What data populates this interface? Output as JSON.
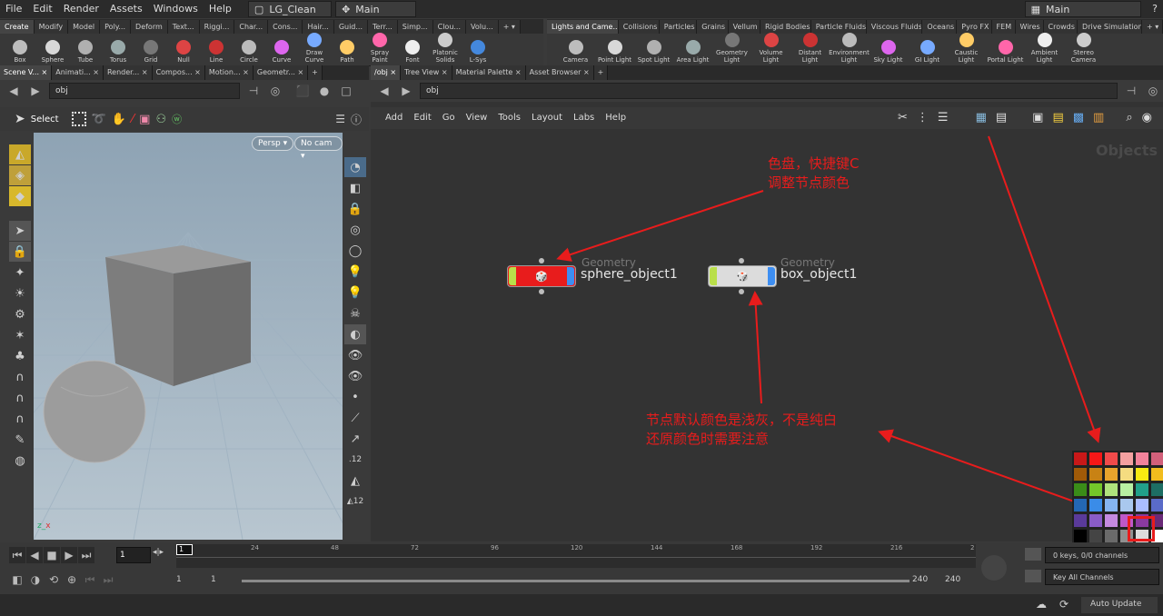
{
  "menubar": {
    "items": [
      "File",
      "Edit",
      "Render",
      "Assets",
      "Windows",
      "Help"
    ],
    "desktop": "LG_Clean",
    "layout": "Main",
    "right": "Main",
    "help": "?"
  },
  "shelf_left": {
    "tabs": [
      "Create",
      "Modify",
      "Model",
      "Poly...",
      "Deform",
      "Text...",
      "Riggi...",
      "Char...",
      "Cons...",
      "Hair...",
      "Guid...",
      "Terr...",
      "Simp...",
      "Clou...",
      "Volu..."
    ],
    "tools": [
      "Box",
      "Sphere",
      "Tube",
      "Torus",
      "Grid",
      "Null",
      "Line",
      "Circle",
      "Curve",
      "Draw Curve",
      "Path",
      "Spray Paint",
      "Font",
      "Platonic Solids",
      "L-Sys"
    ]
  },
  "shelf_right": {
    "tabs": [
      "Lights and Came...",
      "Collisions",
      "Particles",
      "Grains",
      "Vellum",
      "Rigid Bodies",
      "Particle Fluids",
      "Viscous Fluids",
      "Oceans",
      "Pyro FX",
      "FEM",
      "Wires",
      "Crowds",
      "Drive Simulation"
    ],
    "tools": [
      "Camera",
      "Point Light",
      "Spot Light",
      "Area Light",
      "Geometry Light",
      "Volume Light",
      "Distant Light",
      "Environment Light",
      "Sky Light",
      "GI Light",
      "Caustic Light",
      "Portal Light",
      "Ambient Light",
      "Stereo Camera"
    ]
  },
  "left_pane": {
    "tabs": [
      "Scene V...",
      "Animati...",
      "Render...",
      "Compos...",
      "Motion...",
      "Geometr..."
    ],
    "path": "obj",
    "select_label": "Select",
    "persp": "Persp",
    "nocam": "No cam"
  },
  "right_pane": {
    "tabs": [
      "/obj",
      "Tree View",
      "Material Palette",
      "Asset Browser"
    ],
    "path": "obj",
    "menu": [
      "Add",
      "Edit",
      "Go",
      "View",
      "Tools",
      "Layout",
      "Labs",
      "Help"
    ],
    "context_label": "Objects"
  },
  "nodes": [
    {
      "type": "Geometry",
      "name": "sphere_object1",
      "color": "#e81c1c"
    },
    {
      "type": "Geometry",
      "name": "box_object1",
      "color": "#dcdcdc"
    }
  ],
  "annotations": {
    "palette_note_1": "色盘，快捷键C",
    "palette_note_2": "调整节点颜色",
    "default_note_1": "节点默认颜色是浅灰，不是纯白",
    "default_note_2": "还原颜色时需要注意",
    "color": "#e81c1c"
  },
  "palette": [
    "#c81818",
    "#f51717",
    "#f04a4a",
    "#f3a0a0",
    "#f2829a",
    "#d2607a",
    "#a05a08",
    "#c88214",
    "#e9a42c",
    "#f5dc80",
    "#f8ea12",
    "#f2bd1e",
    "#3a8c18",
    "#74c72a",
    "#b0e37c",
    "#b8f0a2",
    "#21a08a",
    "#1d6e64",
    "#2467b4",
    "#3a8ce8",
    "#86b4f0",
    "#a9c8ee",
    "#aabdff",
    "#5a6bc8",
    "#5a3a9a",
    "#8a5cc8",
    "#c48ae0",
    "#bf58c8",
    "#8a3aa0",
    "#6a2a78",
    "#000000",
    "#444444",
    "#6a6a6a",
    "#909090",
    "#dcdcdc",
    "#ffffff"
  ],
  "timeline": {
    "ticks": [
      "1",
      "24",
      "48",
      "72",
      "96",
      "120",
      "144",
      "168",
      "192",
      "216",
      "2"
    ],
    "frame": "1",
    "start": "1",
    "start2": "1",
    "end": "240",
    "end2": "240",
    "keys": "0 keys, 0/0 channels",
    "key_all": "Key All Channels",
    "auto_update": "Auto Update"
  }
}
